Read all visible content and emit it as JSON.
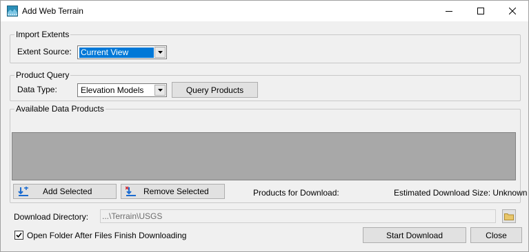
{
  "window": {
    "title": "Add Web Terrain",
    "minimize_icon": "minimize-icon",
    "maximize_icon": "maximize-icon",
    "close_icon": "close-icon"
  },
  "import_extents": {
    "legend": "Import Extents",
    "extent_source_label": "Extent Source:",
    "extent_source_value": "Current View"
  },
  "product_query": {
    "legend": "Product Query",
    "data_type_label": "Data Type:",
    "data_type_value": "Elevation Models",
    "query_button": "Query Products"
  },
  "available_products": {
    "legend": "Available Data Products",
    "add_selected": "Add Selected",
    "remove_selected": "Remove Selected",
    "products_for_download": "Products for Download:",
    "estimated_size": "Estimated Download Size: Unknown"
  },
  "download": {
    "directory_label": "Download Directory:",
    "directory_value": "...\\Terrain\\USGS",
    "open_folder_label": "Open Folder After Files Finish Downloading",
    "open_folder_checked": true,
    "start_button": "Start Download",
    "close_button": "Close"
  },
  "colors": {
    "selection": "#0078d7",
    "list_background": "#a8a8a8",
    "add_icon": "#1a6bd0",
    "remove_icon": "#d0202a",
    "folder_icon": "#e8c66a"
  }
}
